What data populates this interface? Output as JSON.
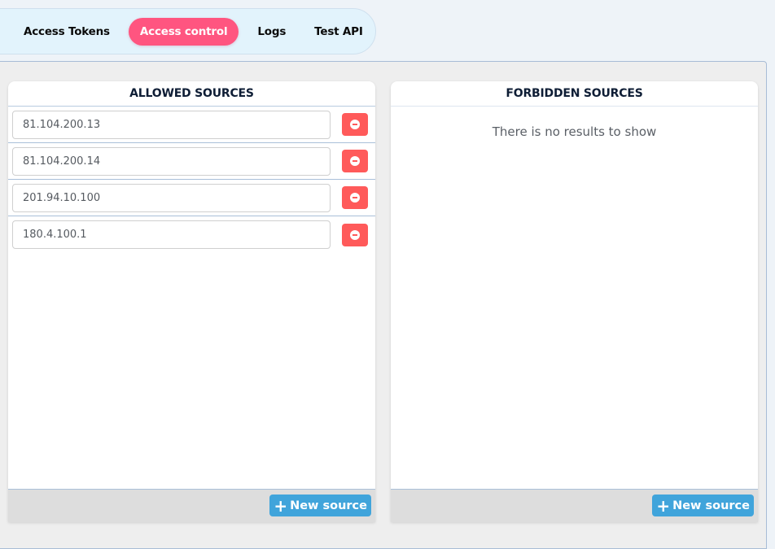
{
  "tabs": [
    {
      "label": "Access Tokens",
      "active": false
    },
    {
      "label": "Access control",
      "active": true
    },
    {
      "label": "Logs",
      "active": false
    },
    {
      "label": "Test API",
      "active": false
    }
  ],
  "allowed": {
    "title": "ALLOWED SOURCES",
    "sources": [
      "81.104.200.13",
      "81.104.200.14",
      "201.94.10.100",
      "180.4.100.1"
    ],
    "remove_icon": "minus-circle-icon",
    "new_button_label": "New source",
    "new_button_icon": "plus-icon"
  },
  "forbidden": {
    "title": "FORBIDDEN SOURCES",
    "empty_message": "There is no results to show",
    "new_button_label": "New source",
    "new_button_icon": "plus-icon"
  },
  "colors": {
    "active_tab": "#ff5580",
    "remove_button": "#ff5a5a",
    "new_button": "#40a4db"
  }
}
